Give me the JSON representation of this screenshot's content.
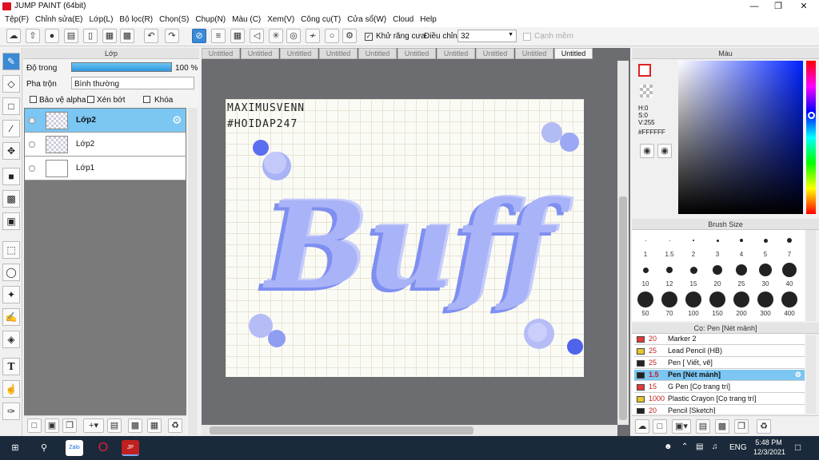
{
  "window": {
    "title": "JUMP PAINT (64bit)"
  },
  "menu": [
    "Tệp(F)",
    "Chỉnh sửa(E)",
    "Lớp(L)",
    "Bộ lọc(R)",
    "Chọn(S)",
    "Chụp(N)",
    "Màu (C)",
    "Xem(V)",
    "Công cụ(T)",
    "Cửa sổ(W)",
    "Cloud",
    "Help"
  ],
  "toolbar": {
    "antialias_label": "Khử răng cưa",
    "adjust_label": "Điều chỉnh",
    "adjust_value": "32",
    "smooth_label": "Cạnh mềm"
  },
  "layer_panel": {
    "title": "Lớp",
    "opacity_label": "Độ trong",
    "opacity_value": "100 %",
    "blend_label": "Pha trộn",
    "blend_value": "Bình thường",
    "protect_alpha": "Bảo vệ alpha",
    "clipping": "Xén bớt",
    "lock": "Khóa",
    "layers": [
      {
        "name": "Lớp2",
        "selected": true
      },
      {
        "name": "Lớp2",
        "selected": false
      },
      {
        "name": "Lớp1",
        "selected": false
      }
    ]
  },
  "tabs": [
    "Untitled",
    "Untitled",
    "Untitled",
    "Untitled",
    "Untitled",
    "Untitled",
    "Untitled",
    "Untitled",
    "Untitled",
    "Untitled"
  ],
  "canvas": {
    "line1": "MAXIMUSVENN",
    "line2": "#HOIDAP247",
    "art_text": "Buff"
  },
  "color_panel": {
    "title": "Màu",
    "h": "H:0",
    "s": "S:0",
    "v": "V:255",
    "hex": "#FFFFFF"
  },
  "brush_size_panel": {
    "title": "Brush Size",
    "sizes": [
      "1",
      "1.5",
      "2",
      "3",
      "4",
      "5",
      "7",
      "10",
      "12",
      "15",
      "20",
      "25",
      "30",
      "40",
      "50",
      "70",
      "100",
      "150",
      "200",
      "300",
      "400"
    ]
  },
  "brush_list": {
    "title": "Cọ: Pen [Nét mảnh]",
    "items": [
      {
        "size": "20",
        "name": "Marker 2",
        "color": "#e23a3a"
      },
      {
        "size": "25",
        "name": "Lead Pencil (HB)",
        "color": "#e8c62a"
      },
      {
        "size": "25",
        "name": "Pen [ Viết, vẽ]",
        "color": "#222222"
      },
      {
        "size": "1.5",
        "name": "Pen [Nét mảnh]",
        "color": "#222222",
        "selected": true
      },
      {
        "size": "15",
        "name": "G Pen [Cọ trang trí]",
        "color": "#e23a3a"
      },
      {
        "size": "1000",
        "name": "Plastic Crayon [Cọ trang trí]",
        "color": "#e8c62a"
      },
      {
        "size": "20",
        "name": "Pencil [Sketch]",
        "color": "#222222"
      }
    ]
  },
  "taskbar": {
    "lang": "ENG",
    "time": "5:48 PM",
    "date": "12/3/2021"
  }
}
